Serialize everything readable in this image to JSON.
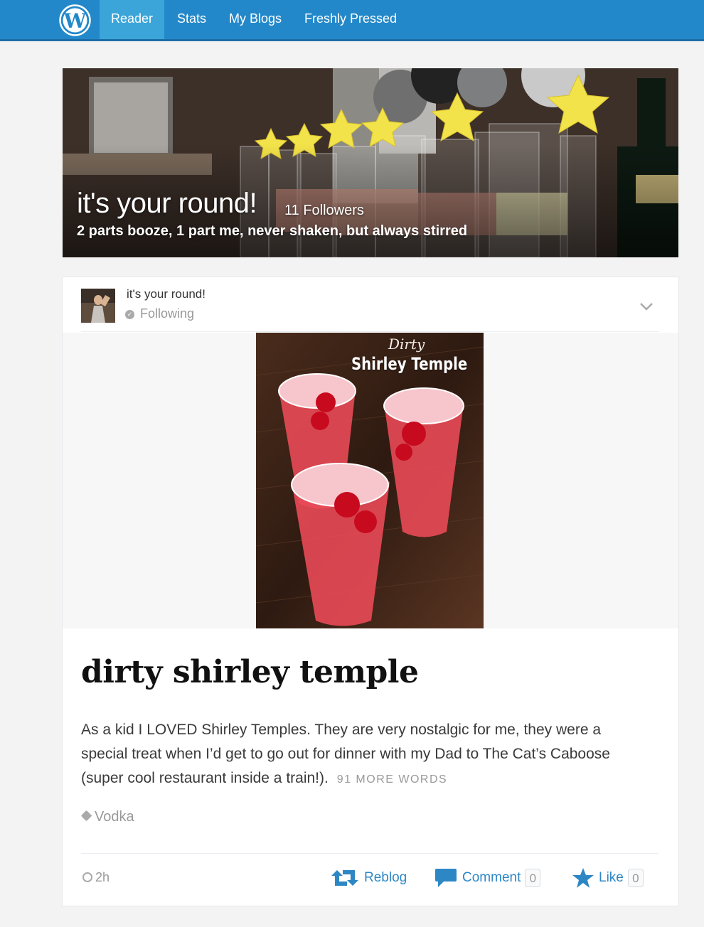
{
  "nav": {
    "items": [
      {
        "label": "Reader",
        "active": true
      },
      {
        "label": "Stats",
        "active": false
      },
      {
        "label": "My Blogs",
        "active": false
      },
      {
        "label": "Freshly Pressed",
        "active": false
      }
    ],
    "accent_color": "#2388c9"
  },
  "banner": {
    "title": "it's your round!",
    "followers": "11 Followers",
    "tagline": "2 parts booze, 1 part me, never shaken, but always stirred"
  },
  "post": {
    "site_name": "it's your round!",
    "follow_status": "Following",
    "image_caption_small": "Dirty",
    "image_caption_big": "Shirley Temple",
    "title": "dirty shirley temple",
    "excerpt": "As a kid I LOVED Shirley Temples. They are very nostalgic for me, they were a special treat when I’d get to go out for dinner with my Dad to The Cat’s Caboose (super cool restaurant inside a train!).",
    "more_words": "91 MORE WORDS",
    "tag": "Vodka",
    "time": "2h",
    "actions": {
      "reblog_label": "Reblog",
      "comment_label": "Comment",
      "comment_count": "0",
      "like_label": "Like",
      "like_count": "0"
    }
  }
}
